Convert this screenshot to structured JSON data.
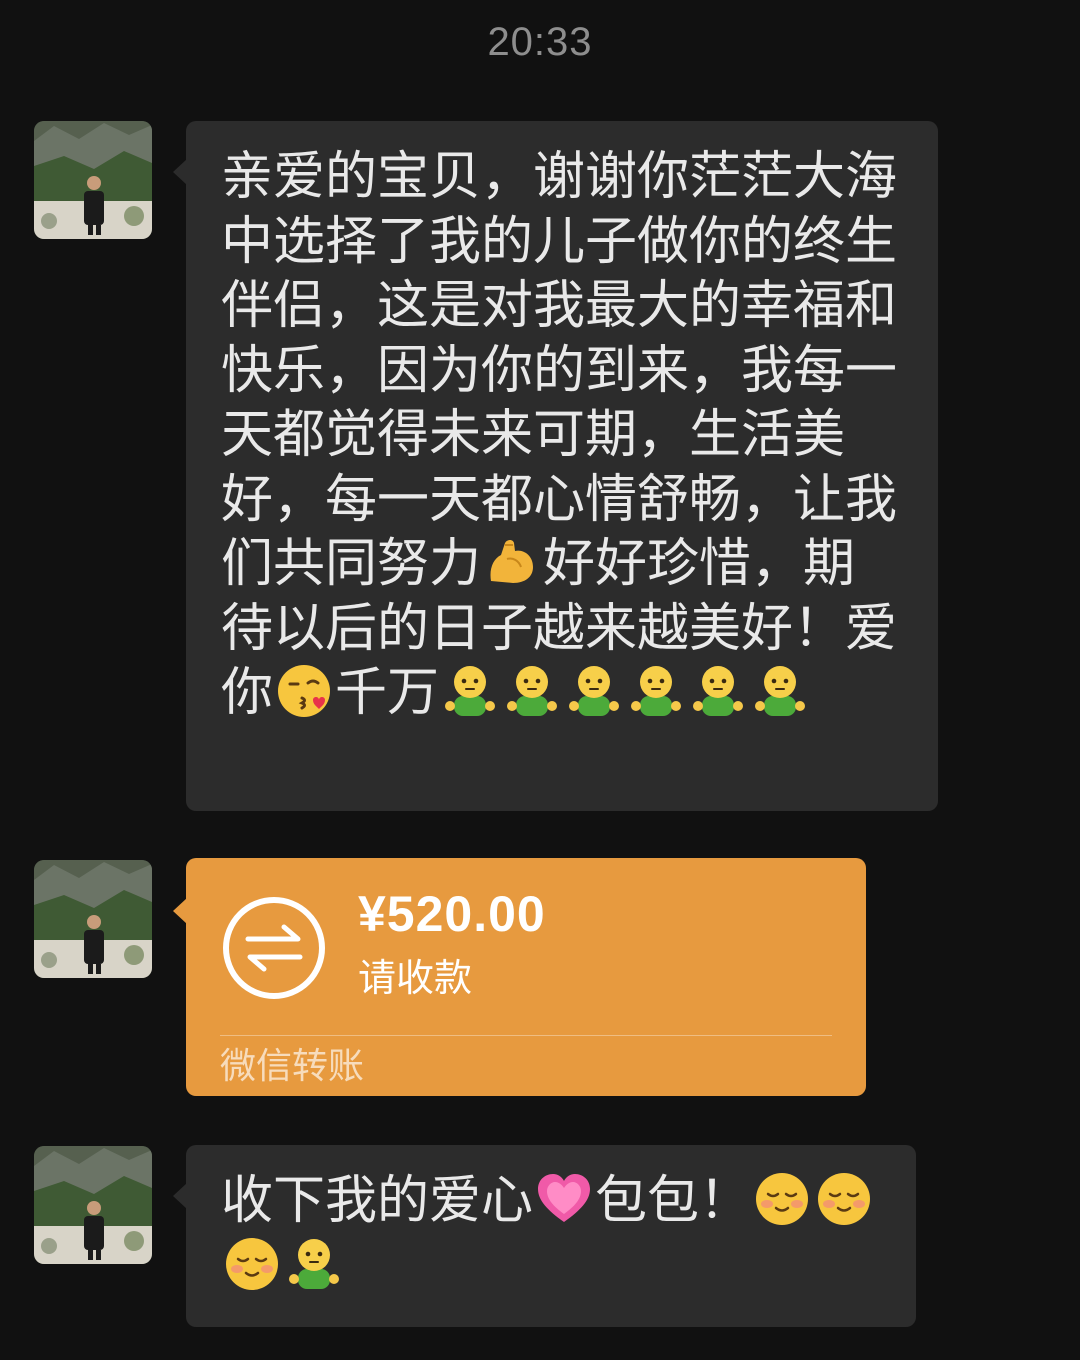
{
  "header": {
    "timestamp": "20:33"
  },
  "messages": [
    {
      "type": "text",
      "sender": "contact",
      "segments": [
        {
          "t": "text",
          "v": "亲爱的宝贝，谢谢你茫茫大海中选择了我的儿子做你的终生伴侣，这是对我最大的幸福和快乐，因为你的到来，我每一天都觉得未来可期，生活美好，每一天都心情舒畅，让我们共同努力"
        },
        {
          "t": "emoji",
          "v": "flexed-biceps-icon"
        },
        {
          "t": "text",
          "v": "好好珍惜，期待以后的日子越来越美好！爱你"
        },
        {
          "t": "emoji",
          "v": "kissing-face-icon"
        },
        {
          "t": "text",
          "v": "千万"
        },
        {
          "t": "emoji",
          "v": "greeting-figure-icon"
        },
        {
          "t": "emoji",
          "v": "greeting-figure-icon"
        },
        {
          "t": "emoji",
          "v": "greeting-figure-icon"
        },
        {
          "t": "emoji",
          "v": "greeting-figure-icon"
        },
        {
          "t": "emoji",
          "v": "greeting-figure-icon"
        },
        {
          "t": "emoji",
          "v": "greeting-figure-icon"
        }
      ]
    },
    {
      "type": "transfer",
      "sender": "contact",
      "amount": "¥520.00",
      "status": "请收款",
      "footer": "微信转账",
      "icon": "transfer-arrows-icon"
    },
    {
      "type": "text",
      "sender": "contact",
      "segments": [
        {
          "t": "text",
          "v": "收下我的爱心"
        },
        {
          "t": "emoji",
          "v": "pink-heart-icon"
        },
        {
          "t": "text",
          "v": "包包！"
        },
        {
          "t": "emoji",
          "v": "blushing-face-icon"
        },
        {
          "t": "emoji",
          "v": "blushing-face-icon"
        },
        {
          "t": "emoji",
          "v": "blushing-face-icon"
        },
        {
          "t": "emoji",
          "v": "greeting-figure-icon"
        }
      ]
    }
  ],
  "colors": {
    "background": "#111111",
    "bubble": "#2c2c2c",
    "bubble_text": "#e9e9e9",
    "transfer": "#e79a3f",
    "timestamp": "#8e8e8e"
  }
}
